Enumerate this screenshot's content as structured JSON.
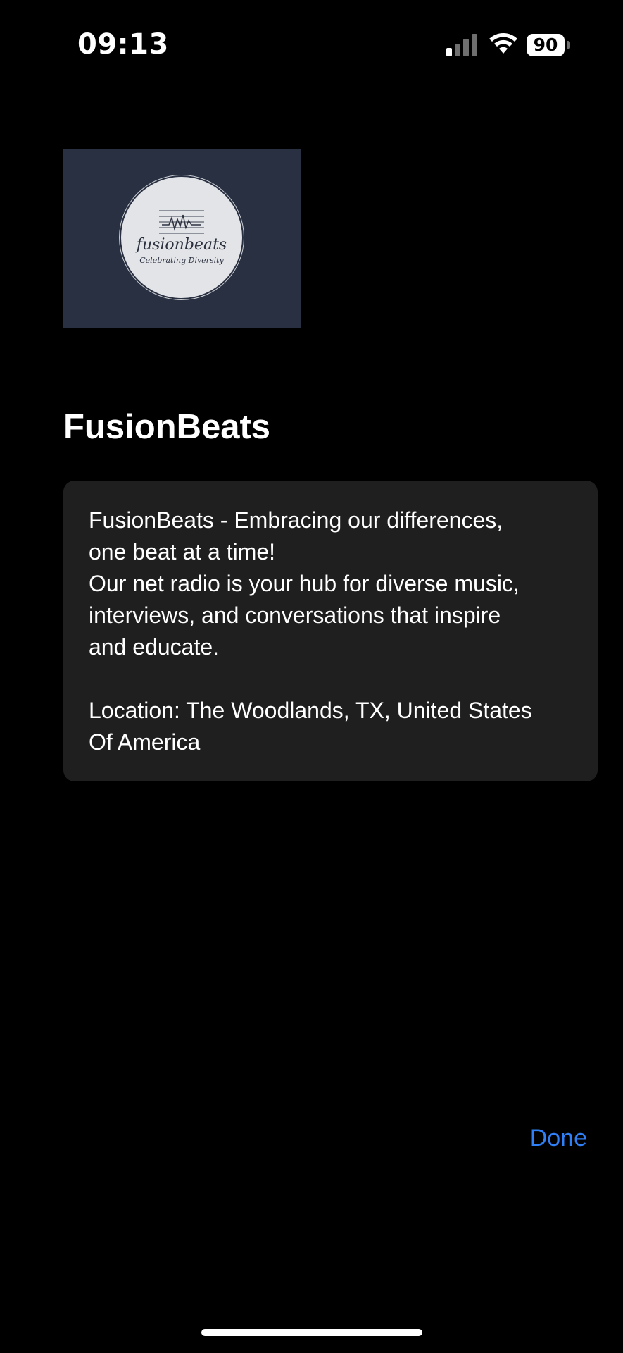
{
  "status_bar": {
    "time": "09:13",
    "battery_level": "90",
    "signal_icon": "cellular-signal-icon",
    "wifi_icon": "wifi-icon",
    "battery_icon": "battery-icon"
  },
  "artwork": {
    "wordmark": "fusionbeats",
    "tagline": "Celebrating Diversity",
    "background_color": "#283041"
  },
  "station": {
    "title": "FusionBeats",
    "description_lines": [
      "FusionBeats - Embracing our differences,",
      "one beat at a time!",
      "Our net radio is your hub for diverse music,",
      "interviews, and conversations that inspire",
      "and educate."
    ],
    "location_lines": [
      "Location: The Woodlands, TX, United States",
      "Of America"
    ]
  },
  "actions": {
    "done_label": "Done"
  },
  "colors": {
    "background": "#000000",
    "card": "#1f1f1f",
    "accent": "#2f7ff6"
  }
}
